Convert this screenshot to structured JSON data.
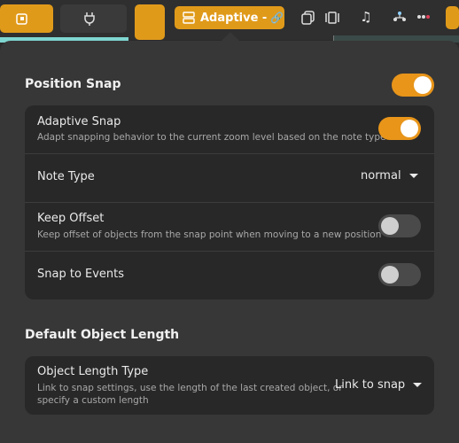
{
  "toolbar": {
    "snap_mode_label": "Adaptive -",
    "snap_mode_icon": "link-icon"
  },
  "popover": {
    "position_snap": {
      "title": "Position Snap",
      "enabled": true,
      "rows": {
        "adaptive_snap": {
          "title": "Adaptive Snap",
          "subtitle": "Adapt snapping behavior to the current zoom level based on the note type",
          "enabled": true
        },
        "note_type": {
          "title": "Note Type",
          "value": "normal"
        },
        "keep_offset": {
          "title": "Keep Offset",
          "subtitle": "Keep offset of objects from the snap point when moving to a new position",
          "enabled": false
        },
        "snap_to_events": {
          "title": "Snap to Events",
          "enabled": false
        }
      }
    },
    "default_object_length": {
      "title": "Default Object Length",
      "rows": {
        "object_length_type": {
          "title": "Object Length Type",
          "subtitle_line1": "Link to snap settings, use the length of the last created object, or",
          "subtitle_line2": "specify a custom length",
          "value": "Link to snap"
        }
      }
    }
  },
  "colors": {
    "accent": "#e8951a",
    "background": "#373737",
    "card": "#282828"
  }
}
